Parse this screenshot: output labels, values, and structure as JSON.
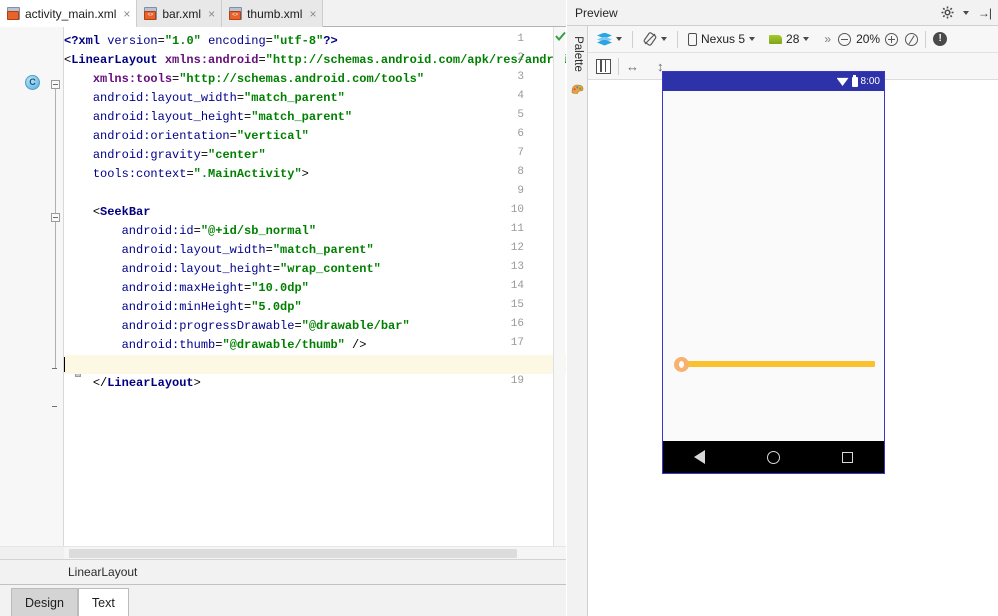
{
  "editor": {
    "tabs": [
      {
        "label": "activity_main.xml",
        "icon": "layout-xml-file-icon",
        "active": true,
        "close": "×"
      },
      {
        "label": "bar.xml",
        "icon": "drawable-xml-file-icon",
        "active": false,
        "close": "×"
      },
      {
        "label": "thumb.xml",
        "icon": "drawable-xml-file-icon",
        "active": false,
        "close": "×"
      }
    ],
    "line_numbers": [
      "1",
      "2",
      "3",
      "4",
      "5",
      "6",
      "7",
      "8",
      "9",
      "10",
      "11",
      "12",
      "13",
      "14",
      "15",
      "16",
      "17",
      "18",
      "19"
    ],
    "class_marker": "C",
    "highlighted_line": 18,
    "caret_line": 18,
    "status_ok": "no-errors-check",
    "code_lines": [
      {
        "num": 1,
        "tokens": [
          {
            "t": "decl",
            "s": "<?xml "
          },
          {
            "t": "attr",
            "s": "version"
          },
          {
            "t": "punc",
            "s": "="
          },
          {
            "t": "val",
            "s": "\"1.0\""
          },
          {
            "t": "plain",
            "s": " "
          },
          {
            "t": "attr",
            "s": "encoding"
          },
          {
            "t": "punc",
            "s": "="
          },
          {
            "t": "val",
            "s": "\"utf-8\""
          },
          {
            "t": "decl",
            "s": "?>"
          }
        ]
      },
      {
        "num": 2,
        "tokens": [
          {
            "t": "punc",
            "s": "<"
          },
          {
            "t": "tag",
            "s": "LinearLayout"
          },
          {
            "t": "plain",
            "s": " "
          },
          {
            "t": "ns",
            "s": "xmlns:android"
          },
          {
            "t": "punc",
            "s": "="
          },
          {
            "t": "val",
            "s": "\"http://schemas.android.com/apk/res/android\""
          }
        ]
      },
      {
        "num": 3,
        "tokens": [
          {
            "t": "plain",
            "s": "    "
          },
          {
            "t": "ns",
            "s": "xmlns:tools"
          },
          {
            "t": "punc",
            "s": "="
          },
          {
            "t": "val",
            "s": "\"http://schemas.android.com/tools\""
          }
        ]
      },
      {
        "num": 4,
        "tokens": [
          {
            "t": "plain",
            "s": "    "
          },
          {
            "t": "attr",
            "s": "android:layout_width"
          },
          {
            "t": "punc",
            "s": "="
          },
          {
            "t": "val",
            "s": "\"match_parent\""
          }
        ]
      },
      {
        "num": 5,
        "tokens": [
          {
            "t": "plain",
            "s": "    "
          },
          {
            "t": "attr",
            "s": "android:layout_height"
          },
          {
            "t": "punc",
            "s": "="
          },
          {
            "t": "val",
            "s": "\"match_parent\""
          }
        ]
      },
      {
        "num": 6,
        "tokens": [
          {
            "t": "plain",
            "s": "    "
          },
          {
            "t": "attr",
            "s": "android:orientation"
          },
          {
            "t": "punc",
            "s": "="
          },
          {
            "t": "val",
            "s": "\"vertical\""
          }
        ]
      },
      {
        "num": 7,
        "tokens": [
          {
            "t": "plain",
            "s": "    "
          },
          {
            "t": "attr",
            "s": "android:gravity"
          },
          {
            "t": "punc",
            "s": "="
          },
          {
            "t": "val",
            "s": "\"center\""
          }
        ]
      },
      {
        "num": 8,
        "tokens": [
          {
            "t": "plain",
            "s": "    "
          },
          {
            "t": "attr",
            "s": "tools:context"
          },
          {
            "t": "punc",
            "s": "="
          },
          {
            "t": "val",
            "s": "\".MainActivity\""
          },
          {
            "t": "punc",
            "s": ">"
          }
        ]
      },
      {
        "num": 9,
        "tokens": []
      },
      {
        "num": 10,
        "tokens": [
          {
            "t": "plain",
            "s": "    "
          },
          {
            "t": "punc",
            "s": "<"
          },
          {
            "t": "tag",
            "s": "SeekBar"
          }
        ]
      },
      {
        "num": 11,
        "tokens": [
          {
            "t": "plain",
            "s": "        "
          },
          {
            "t": "attr",
            "s": "android:id"
          },
          {
            "t": "punc",
            "s": "="
          },
          {
            "t": "val",
            "s": "\"@+id/sb_normal\""
          }
        ]
      },
      {
        "num": 12,
        "tokens": [
          {
            "t": "plain",
            "s": "        "
          },
          {
            "t": "attr",
            "s": "android:layout_width"
          },
          {
            "t": "punc",
            "s": "="
          },
          {
            "t": "val",
            "s": "\"match_parent\""
          }
        ]
      },
      {
        "num": 13,
        "tokens": [
          {
            "t": "plain",
            "s": "        "
          },
          {
            "t": "attr",
            "s": "android:layout_height"
          },
          {
            "t": "punc",
            "s": "="
          },
          {
            "t": "val",
            "s": "\"wrap_content\""
          }
        ]
      },
      {
        "num": 14,
        "tokens": [
          {
            "t": "plain",
            "s": "        "
          },
          {
            "t": "attr",
            "s": "android:maxHeight"
          },
          {
            "t": "punc",
            "s": "="
          },
          {
            "t": "val",
            "s": "\"10.0dp\""
          }
        ]
      },
      {
        "num": 15,
        "tokens": [
          {
            "t": "plain",
            "s": "        "
          },
          {
            "t": "attr",
            "s": "android:minHeight"
          },
          {
            "t": "punc",
            "s": "="
          },
          {
            "t": "val",
            "s": "\"5.0dp\""
          }
        ]
      },
      {
        "num": 16,
        "tokens": [
          {
            "t": "plain",
            "s": "        "
          },
          {
            "t": "attr",
            "s": "android:progressDrawable"
          },
          {
            "t": "punc",
            "s": "="
          },
          {
            "t": "val",
            "s": "\"@drawable/bar\""
          }
        ]
      },
      {
        "num": 17,
        "tokens": [
          {
            "t": "plain",
            "s": "        "
          },
          {
            "t": "attr",
            "s": "android:thumb"
          },
          {
            "t": "punc",
            "s": "="
          },
          {
            "t": "val",
            "s": "\"@drawable/thumb\""
          },
          {
            "t": "punc",
            "s": " />"
          }
        ]
      },
      {
        "num": 18,
        "tokens": []
      },
      {
        "num": 19,
        "tokens": [
          {
            "t": "plain",
            "s": "    "
          },
          {
            "t": "punc",
            "s": "</"
          },
          {
            "t": "tag",
            "s": "LinearLayout"
          },
          {
            "t": "punc",
            "s": ">"
          }
        ]
      }
    ],
    "breadcrumb": "LinearLayout",
    "bottom_tabs": [
      {
        "label": "Design",
        "active": false
      },
      {
        "label": "Text",
        "active": true
      }
    ]
  },
  "preview": {
    "header_title": "Preview",
    "settings_icon": "gear-icon",
    "collapse_icon": "hide-panel-icon",
    "palette_label": "Palette",
    "palette_icon": "palette-icon",
    "toolbar": {
      "render_mode_icon": "layers-icon",
      "orientation_icon": "rotate-device-icon",
      "device_icon": "phone-icon",
      "device_name": "Nexus 5",
      "api_icon": "android-api-icon",
      "api_level": "28",
      "overflow": "»",
      "zoom_out_icon": "zoom-out-icon",
      "zoom_level": "20%",
      "zoom_in_icon": "zoom-in-icon",
      "zoom_fit_icon": "zoom-to-fit-icon",
      "issues_icon": "issue-notification-icon"
    },
    "toolbar2": {
      "columns_icon": "blueprint-columns-icon",
      "width_icon": "horizontal-resize-icon",
      "height_icon": "vertical-resize-icon"
    },
    "device": {
      "status_bar": {
        "wifi_icon": "wifi-icon",
        "battery_icon": "battery-icon",
        "time": "8:00",
        "background": "#2e32a8"
      },
      "seekbar": {
        "name": "sb_normal",
        "progress": 0,
        "track_color": "#fbc02d",
        "thumb_color": "#f7b270"
      },
      "nav_bar": {
        "back_icon": "nav-back-icon",
        "home_icon": "nav-home-icon",
        "recents_icon": "nav-recents-icon",
        "background": "#000000"
      }
    }
  }
}
